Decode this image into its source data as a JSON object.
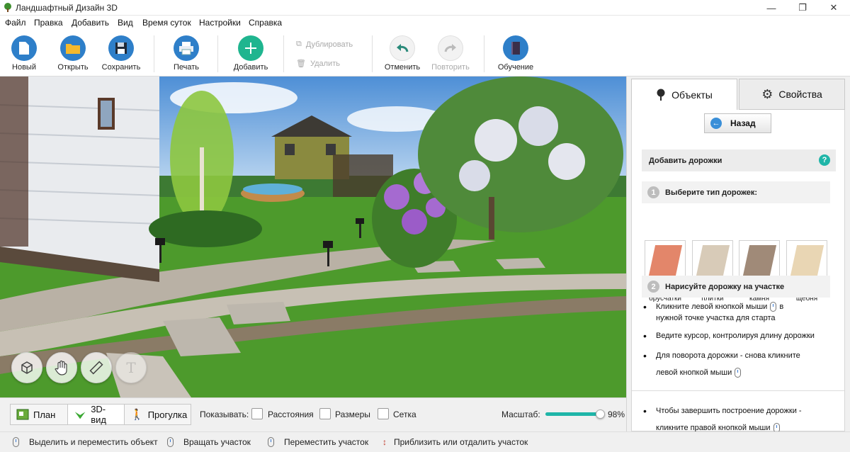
{
  "window": {
    "title": "Ландшафтный Дизайн 3D",
    "minimize": "—",
    "maximize": "❐",
    "close": "✕"
  },
  "menu": [
    "Файл",
    "Правка",
    "Добавить",
    "Вид",
    "Время суток",
    "Настройки",
    "Справка"
  ],
  "toolbar": {
    "new": "Новый",
    "open": "Открыть",
    "save": "Сохранить",
    "print": "Печать",
    "add": "Добавить",
    "duplicate": "Дублировать",
    "delete": "Удалить",
    "undo": "Отменить",
    "redo": "Повторить",
    "learn": "Обучение"
  },
  "view_modes": {
    "plan": "План",
    "view3d": "3D-вид",
    "walk": "Прогулка"
  },
  "show": {
    "label": "Показывать:",
    "distance": "Расстояния",
    "sizes": "Размеры",
    "grid": "Сетка"
  },
  "scale": {
    "label": "Масштаб:",
    "value_text": "98%",
    "value": 0.98
  },
  "panel": {
    "tab_objects": "Объекты",
    "tab_props": "Свойства",
    "back": "Назад",
    "section_title": "Добавить дорожки",
    "help": "?",
    "step1_num": "1",
    "step1": "Выберите тип дорожек:",
    "types": [
      {
        "label": "Дорожка из брусчатки",
        "color": "#e3866a"
      },
      {
        "label": "Дорожка из плитки",
        "color": "#d8cbb8"
      },
      {
        "label": "Дорожка из камня",
        "color": "#a08a78"
      },
      {
        "label": "Дорожка из щебня",
        "color": "#e9d6b4"
      }
    ],
    "step2_num": "2",
    "step2": "Нарисуйте дорожку на участке",
    "hint1a": "Кликните левой кнопкой мыши",
    "hint1b": "в",
    "hint1c": "нужной точке участка для старта",
    "hint2": "Ведите курсор, контролируя длину дорожки",
    "hint3a": "Для поворота дорожки - снова кликните",
    "hint3b": "левой кнопкой мыши",
    "hint4a": "Чтобы завершить построение дорожки -",
    "hint4b": "кликните правой кнопкой мыши"
  },
  "status": {
    "select": "Выделить и переместить объект",
    "rotate": "Вращать участок",
    "move": "Переместить участок",
    "zoom": "Приблизить или отдалить участок"
  }
}
